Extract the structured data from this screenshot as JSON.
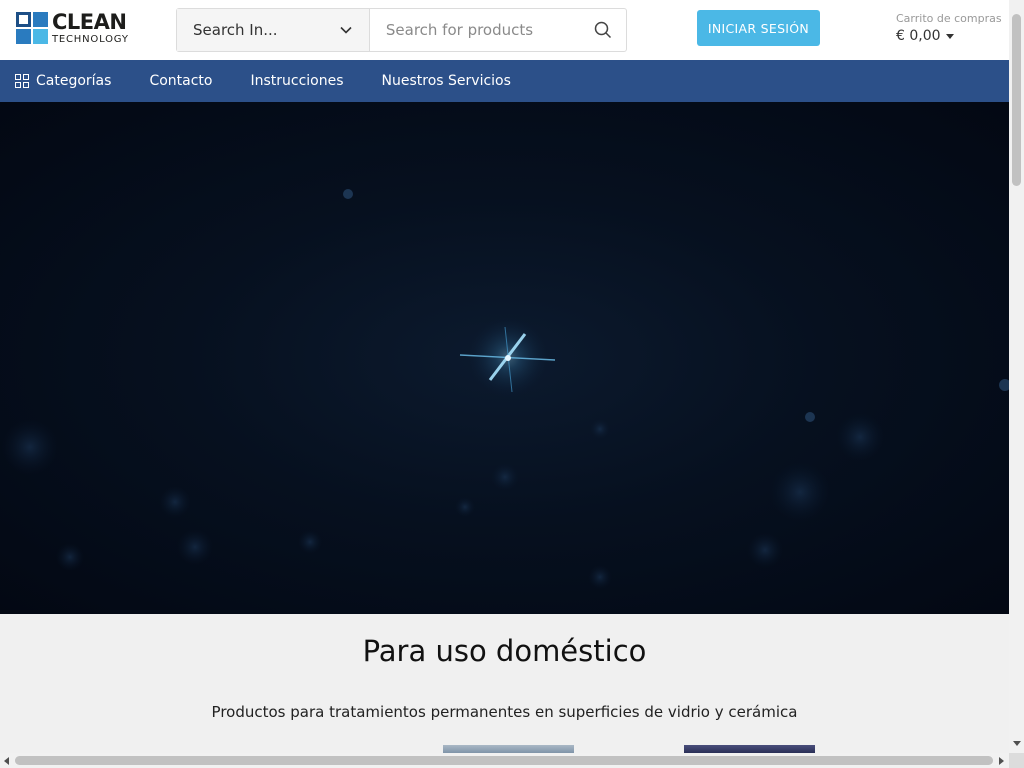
{
  "brand": {
    "name_line1": "CLEAN",
    "name_line2": "TECHNOLOGY",
    "colors": {
      "dark": "#1d4f86",
      "mid": "#2a7bbf",
      "light": "#4bb8e6"
    }
  },
  "search": {
    "category_label": "Search In...",
    "placeholder": "Search for products",
    "icon": "search-icon"
  },
  "header": {
    "login_label": "INICIAR SESIÓN",
    "cart_label": "Carrito de compras",
    "cart_total": "€ 0,00"
  },
  "nav": {
    "items": [
      {
        "label": "Categorías",
        "icon": "grid-icon"
      },
      {
        "label": "Contacto"
      },
      {
        "label": "Instrucciones"
      },
      {
        "label": "Nuestros Servicios"
      }
    ],
    "background": "#2c5089"
  },
  "section": {
    "title": "Para uso doméstico",
    "subtitle": "Productos para tratamientos permanentes en superficies de vidrio y cerámica"
  },
  "accent": "#4bb8e6"
}
